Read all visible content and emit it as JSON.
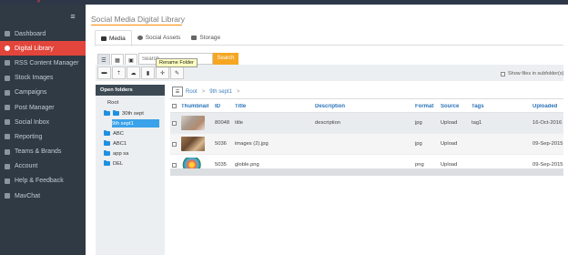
{
  "sidebar": {
    "items": [
      {
        "label": "Dashboard",
        "icon": "dashboard-icon"
      },
      {
        "label": "Digital Library",
        "icon": "library-icon",
        "active": true
      },
      {
        "label": "RSS Content Manager",
        "icon": "rss-icon"
      },
      {
        "label": "Stock Images",
        "icon": "image-icon"
      },
      {
        "label": "Campaigns",
        "icon": "campaign-icon"
      },
      {
        "label": "Post Manager",
        "icon": "post-icon"
      },
      {
        "label": "Social Inbox",
        "icon": "inbox-icon"
      },
      {
        "label": "Reporting",
        "icon": "chart-icon"
      },
      {
        "label": "Teams & Brands",
        "icon": "team-icon"
      },
      {
        "label": "Account",
        "icon": "user-icon"
      },
      {
        "label": "Help & Feedback",
        "icon": "help-icon"
      },
      {
        "label": "MavChat",
        "icon": "chat-icon"
      }
    ]
  },
  "page": {
    "title": "Social Media Digital Library"
  },
  "tabs": [
    {
      "label": "Media",
      "icon": "camera-icon"
    },
    {
      "label": "Social Assets",
      "icon": "globe-icon"
    },
    {
      "label": "Storage",
      "icon": "storage-icon"
    }
  ],
  "search": {
    "placeholder": "Search",
    "button_label": "Search"
  },
  "tooltip": {
    "text": "Rename Folder"
  },
  "toolbar": {
    "show_files_label": "Show files in subfolder(s)"
  },
  "folders": {
    "header": "Open folders",
    "tree": [
      {
        "label": "Root"
      },
      {
        "label": "30th sept"
      },
      {
        "label": "9th sept1",
        "selected": true
      },
      {
        "label": "ABC"
      },
      {
        "label": "ABC1"
      },
      {
        "label": "app sa"
      },
      {
        "label": "DEL"
      }
    ]
  },
  "breadcrumb": {
    "items": [
      "Root",
      "9th sept1"
    ]
  },
  "grid": {
    "columns": [
      "Thumbnail",
      "ID",
      "Title",
      "Description",
      "Format",
      "Source",
      "Tags",
      "Uploaded"
    ],
    "rows": [
      {
        "id": "80048",
        "title": "title",
        "description": "description",
        "format": "jpg",
        "source": "Upload",
        "tags": "tag1",
        "uploaded": "16-Oct-2016"
      },
      {
        "id": "5036",
        "title": "images (2).jpg",
        "description": "",
        "format": "jpg",
        "source": "Upload",
        "tags": "",
        "uploaded": "09-Sep-2015"
      },
      {
        "id": "5035",
        "title": "globle.png",
        "description": "",
        "format": "png",
        "source": "Upload",
        "tags": "",
        "uploaded": "09-Sep-2015"
      }
    ]
  },
  "colors": {
    "accent": "#e2453b",
    "search_button": "#f6a623",
    "sidebar_bg": "#2f3a44",
    "selected_folder": "#3aa2e8",
    "link": "#2a73b8"
  }
}
